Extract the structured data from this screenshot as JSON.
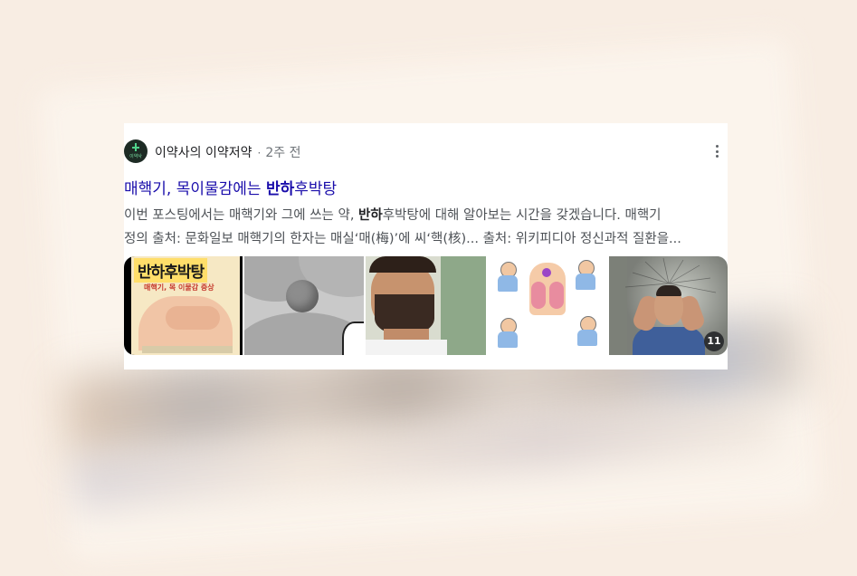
{
  "result": {
    "source_name": "이약사의 이약저약",
    "separator": "·",
    "time_ago": "2주 전",
    "avatar_text": "이약사",
    "title_pre": "매핵기, 목이물감에는 ",
    "title_bold": "반하",
    "title_post": "후박탕",
    "snippet_line1_pre": "이번 포스팅에서는 매핵기와 그에 쓰는 약, ",
    "snippet_line1_bold": "반하",
    "snippet_line1_post": "후박탕에 대해 알아보는 시간을 갖겠습니다. 매핵기",
    "snippet_line2": "정의 출처: 문화일보 매핵기의 한자는 매실‘매(梅)’에 씨‘핵(核)... 출처: 위키피디아 정신과적 질환을...",
    "thumb1_heading": "반하후박탕",
    "thumb1_sub": "매핵기, 목 이물감 증상",
    "image_count": "11"
  },
  "colors": {
    "link": "#1a0dab",
    "snippet": "#4d5156",
    "meta": "#70757a",
    "background": "#f8ede3"
  }
}
